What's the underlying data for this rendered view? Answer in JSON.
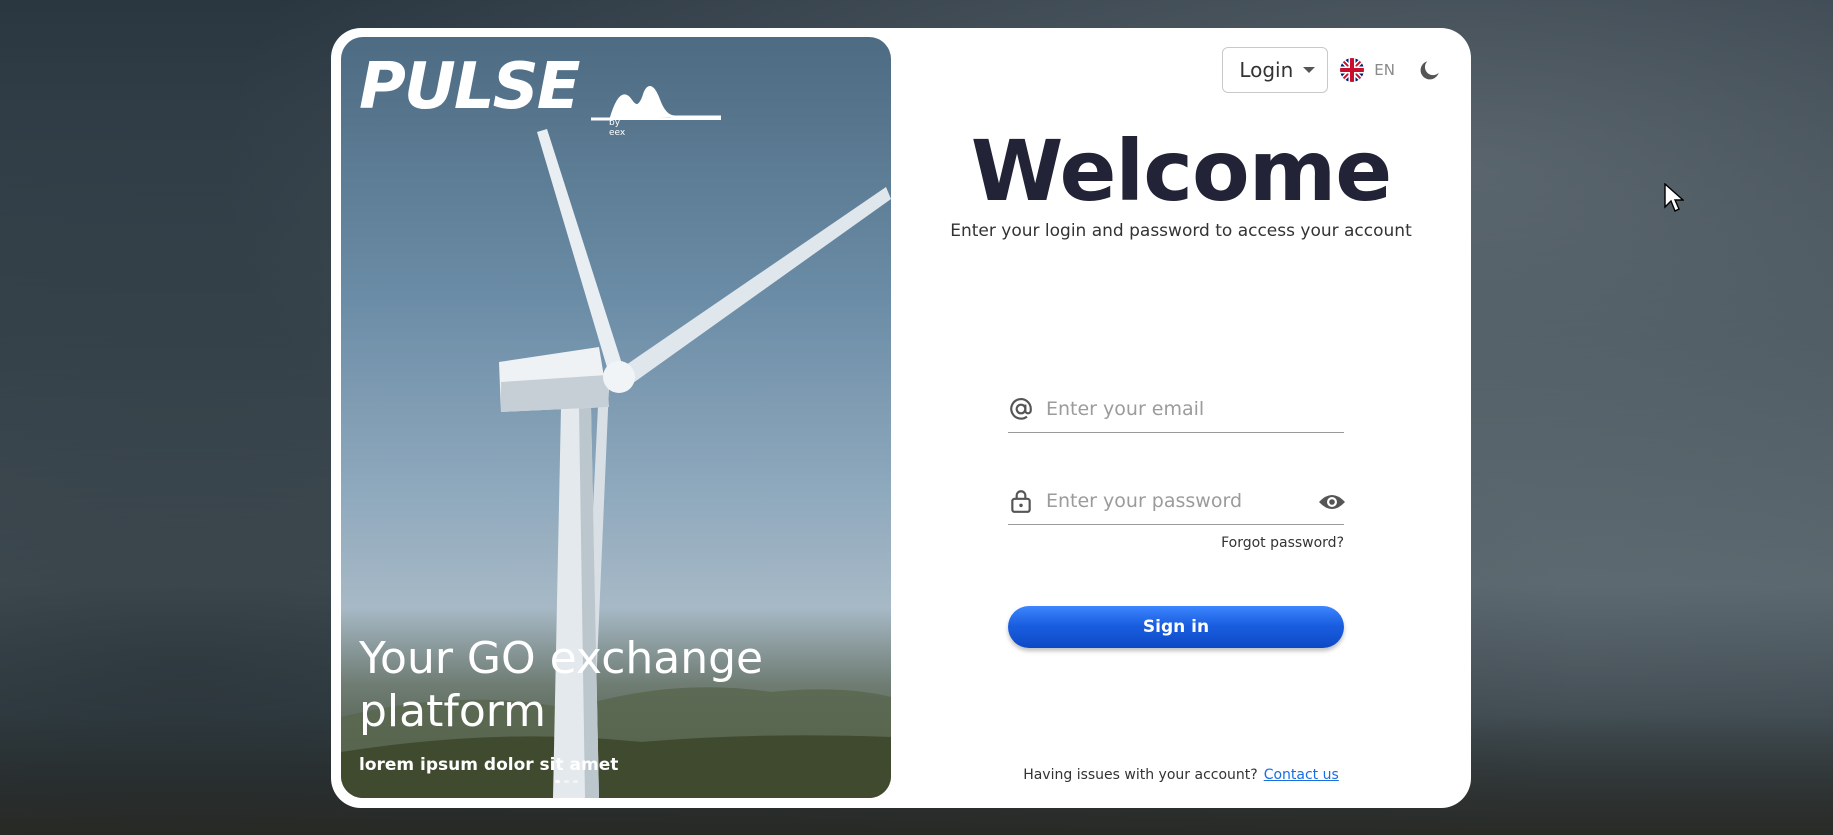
{
  "brand": {
    "logo_text": "PULSE",
    "logo_byline": "by eex"
  },
  "hero": {
    "title": "Your GO exchange platform",
    "subtitle": "lorem ipsum dolor sit amet",
    "slides": 3,
    "active_slide": 1
  },
  "topbar": {
    "mode_select_value": "Login",
    "language_code": "EN",
    "flag_icon": "uk-flag-icon",
    "theme_icon": "moon-icon"
  },
  "login": {
    "welcome": "Welcome",
    "subtitle": "Enter your login and password to access your account",
    "email_placeholder": "Enter your email",
    "email_icon": "at-sign-icon",
    "password_placeholder": "Enter your password",
    "password_icon": "lock-icon",
    "show_password_icon": "eye-icon",
    "forgot_label": "Forgot password?",
    "signin_label": "Sign in",
    "footer_text": "Having issues with your account?",
    "contact_label": "Contact us"
  },
  "colors": {
    "primary": "#1a5fe0",
    "heading": "#232338",
    "link": "#1a6ee0"
  }
}
